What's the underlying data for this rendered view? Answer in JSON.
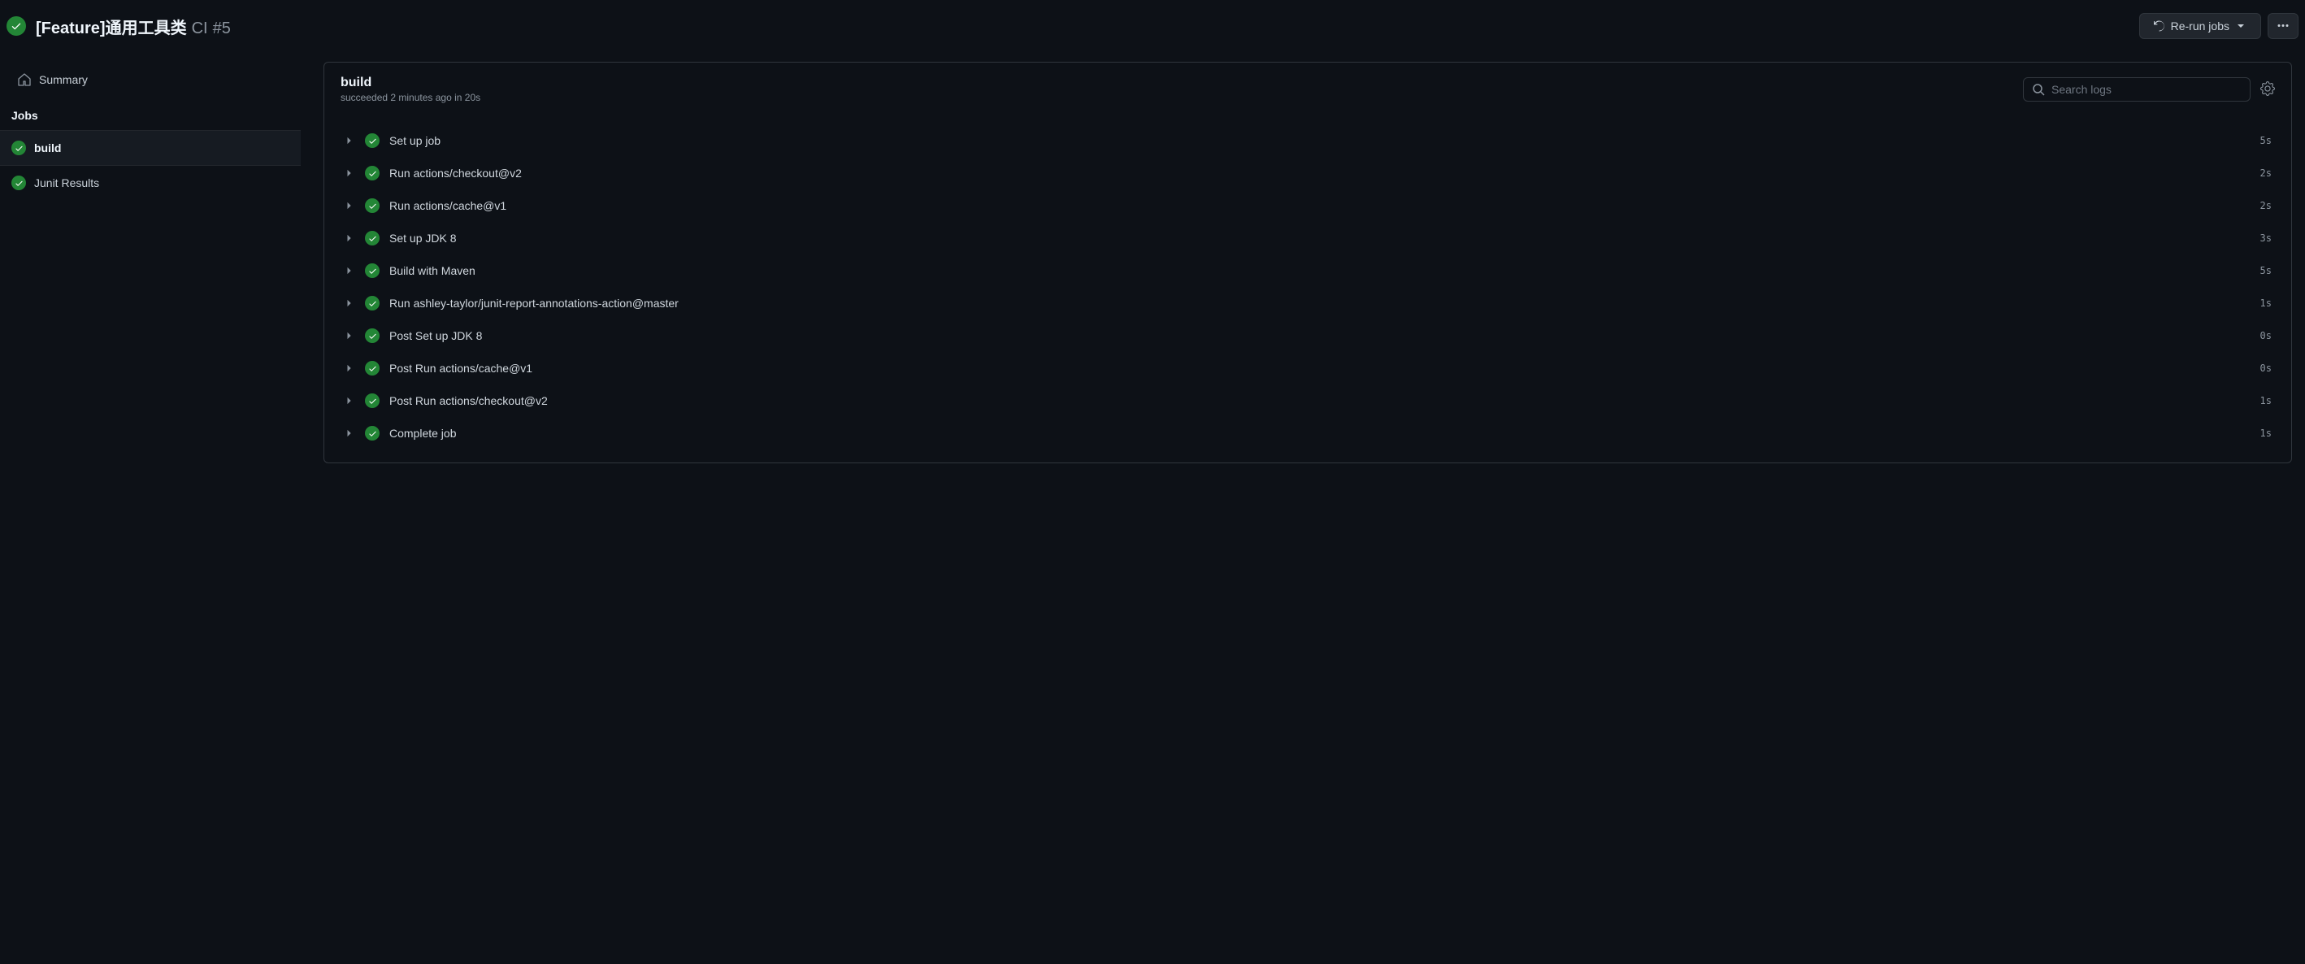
{
  "header": {
    "title_bold": "[Feature]通用工具类",
    "title_workflow": "CI",
    "title_run": "#5",
    "rerun_label": "Re-run jobs"
  },
  "sidebar": {
    "summary_label": "Summary",
    "jobs_heading": "Jobs",
    "jobs": [
      {
        "label": "build",
        "active": true
      },
      {
        "label": "Junit Results",
        "active": false
      }
    ]
  },
  "log": {
    "title": "build",
    "subtitle": "succeeded 2 minutes ago in 20s",
    "search_placeholder": "Search logs"
  },
  "steps": [
    {
      "name": "Set up job",
      "duration": "5s"
    },
    {
      "name": "Run actions/checkout@v2",
      "duration": "2s"
    },
    {
      "name": "Run actions/cache@v1",
      "duration": "2s"
    },
    {
      "name": "Set up JDK 8",
      "duration": "3s"
    },
    {
      "name": "Build with Maven",
      "duration": "5s"
    },
    {
      "name": "Run ashley-taylor/junit-report-annotations-action@master",
      "duration": "1s"
    },
    {
      "name": "Post Set up JDK 8",
      "duration": "0s"
    },
    {
      "name": "Post Run actions/cache@v1",
      "duration": "0s"
    },
    {
      "name": "Post Run actions/checkout@v2",
      "duration": "1s"
    },
    {
      "name": "Complete job",
      "duration": "1s"
    }
  ]
}
